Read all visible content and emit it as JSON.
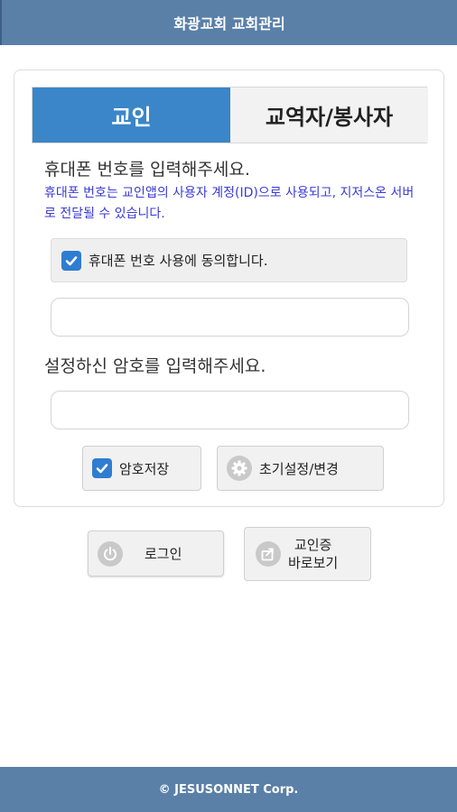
{
  "header": {
    "title": "화광교회 교회관리"
  },
  "tabs": [
    {
      "label": "교인",
      "active": true
    },
    {
      "label": "교역자/봉사자",
      "active": false
    }
  ],
  "phone": {
    "prompt": "휴대폰 번호를 입력해주세요.",
    "notice": "휴대폰 번호는 교인앱의 사용자 계정(ID)으로 사용되고, 지저스온 서버로 전달될 수 있습니다.",
    "agree_label": "휴대폰 번호 사용에 동의합니다.",
    "agree_checked": true,
    "value": ""
  },
  "password": {
    "prompt": "설정하신 암호를 입력해주세요.",
    "value": ""
  },
  "options": {
    "save_label": "암호저장",
    "save_checked": true,
    "reset_label": "초기설정/변경"
  },
  "actions": {
    "login_label": "로그인",
    "card_line1": "교인증",
    "card_line2": "바로보기"
  },
  "footer": {
    "text": "© JESUSONNET Corp."
  },
  "colors": {
    "bar": "#5a80a8",
    "tab_active": "#3b86c8",
    "checkbox": "#2f7dd0",
    "notice_text": "#3a3ad6"
  }
}
